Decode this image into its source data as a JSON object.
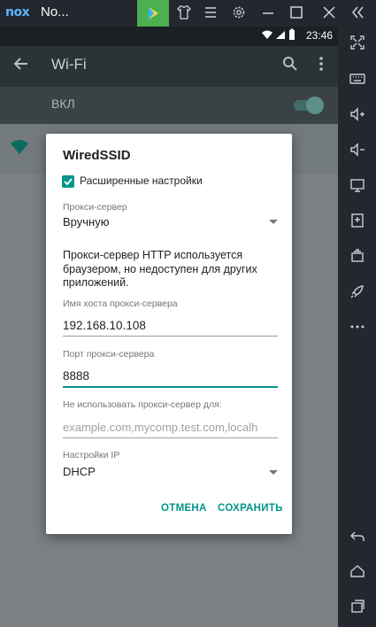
{
  "window": {
    "logo": "nox",
    "title": "No...",
    "buttons": {
      "play": "play-icon",
      "shirt": "shirt-icon",
      "menu": "menu-icon",
      "settings": "gear-icon",
      "minimize": "minimize-icon",
      "maximize": "maximize-icon",
      "close": "close-icon",
      "collapse": "collapse-icon"
    }
  },
  "statusbar": {
    "time": "23:46"
  },
  "appbar": {
    "title": "Wi-Fi"
  },
  "switchbar": {
    "label": "ВКЛ",
    "on": true
  },
  "dialog": {
    "title": "WiredSSID",
    "advanced_label": "Расширенные настройки",
    "advanced_checked": true,
    "proxy_label": "Прокси-сервер",
    "proxy_value": "Вручную",
    "info_text": "Прокси-сервер HTTP используется браузером, но недоступен для других приложений.",
    "host_label": "Имя хоста прокси-сервера",
    "host_value": "192.168.10.108",
    "port_label": "Порт прокси-сервера",
    "port_value": "8888",
    "bypass_label": "Не использовать прокси-сервер для:",
    "bypass_placeholder": "example.com,mycomp.test.com,localh",
    "ip_label": "Настройки IP",
    "ip_value": "DHCP",
    "cancel_label": "ОТМЕНА",
    "save_label": "СОХРАНИТЬ"
  },
  "colors": {
    "accent": "#009688",
    "titlebar": "#23272e",
    "play": "#4caf50"
  }
}
